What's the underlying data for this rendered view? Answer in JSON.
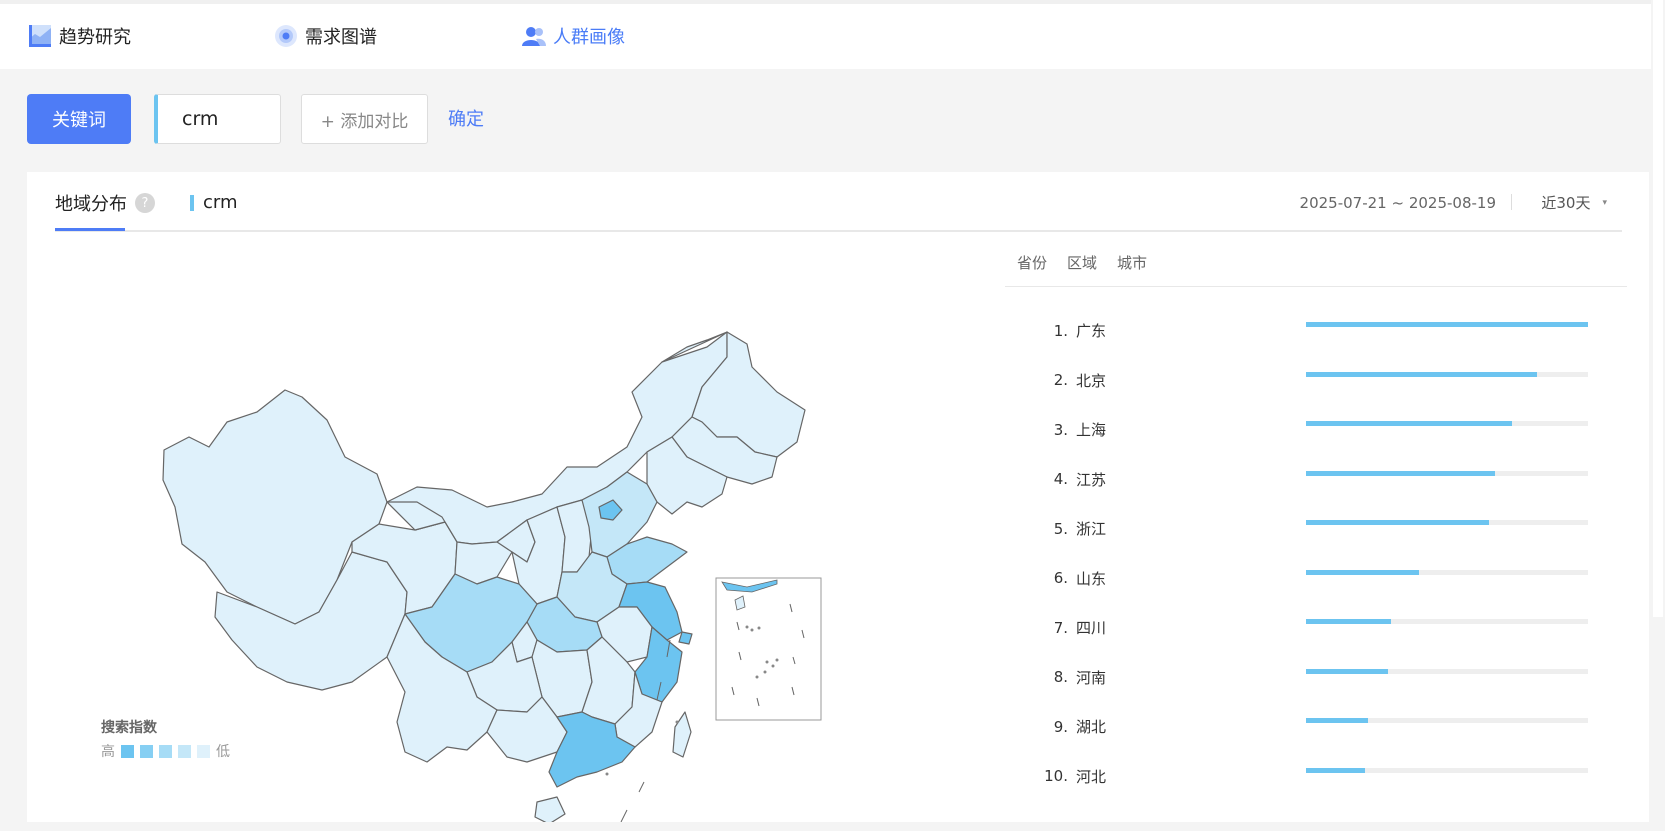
{
  "nav": {
    "items": [
      {
        "label": "趋势研究",
        "icon": "trend-chart-icon"
      },
      {
        "label": "需求图谱",
        "icon": "radar-target-icon"
      },
      {
        "label": "人群画像",
        "icon": "user-group-icon"
      }
    ],
    "active_index": 2,
    "accent_color": "#4a7cf7"
  },
  "search": {
    "keyword_label": "关键词",
    "keyword_value": "crm",
    "add_compare_label": "+ 添加对比",
    "confirm_label": "确定"
  },
  "panel": {
    "tab_label": "地域分布",
    "help_icon": "?",
    "keyword_tag": "crm",
    "date_range": "2025-07-21 ~ 2025-08-19",
    "period_label": "近30天",
    "period_caret": "▾"
  },
  "legend": {
    "title": "搜索指数",
    "high_label": "高",
    "low_label": "低",
    "colors": [
      "#6cc4f0",
      "#86cff3",
      "#a6dcf6",
      "#c4e7f8",
      "#dff1fb"
    ]
  },
  "rank_tabs": [
    "省份",
    "区域",
    "城市"
  ],
  "ranking": [
    {
      "rank": "1.",
      "name": "广东",
      "value": 1.0
    },
    {
      "rank": "2.",
      "name": "北京",
      "value": 0.82
    },
    {
      "rank": "3.",
      "name": "上海",
      "value": 0.73
    },
    {
      "rank": "4.",
      "name": "江苏",
      "value": 0.67
    },
    {
      "rank": "5.",
      "name": "浙江",
      "value": 0.65
    },
    {
      "rank": "6.",
      "name": "山东",
      "value": 0.4
    },
    {
      "rank": "7.",
      "name": "四川",
      "value": 0.3
    },
    {
      "rank": "8.",
      "name": "河南",
      "value": 0.29
    },
    {
      "rank": "9.",
      "name": "湖北",
      "value": 0.22
    },
    {
      "rank": "10.",
      "name": "河北",
      "value": 0.21
    }
  ]
}
